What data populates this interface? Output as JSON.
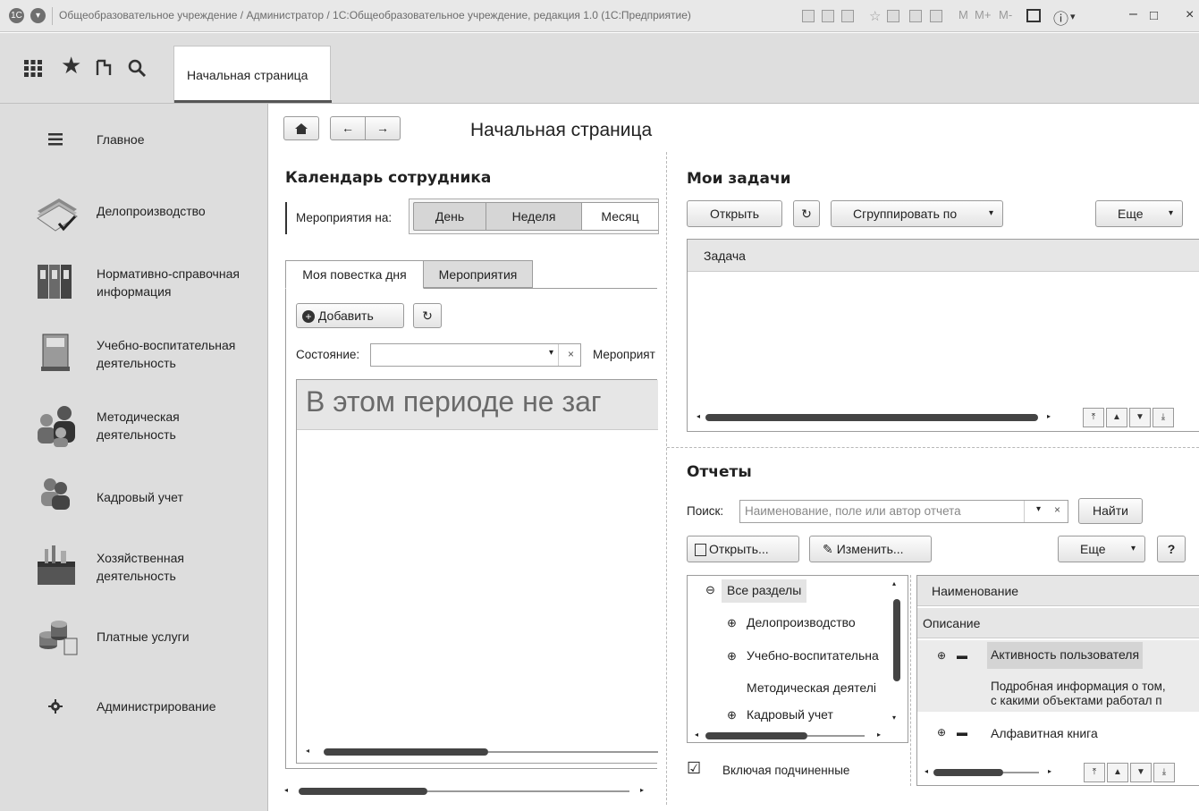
{
  "window": {
    "title": "Общеобразовательное учреждение / Администратор / 1С:Общеобразовательное учреждение, редакция 1.0  (1С:Предприятие)",
    "memory_buttons": [
      "M",
      "M+",
      "M-"
    ]
  },
  "toolbar": {
    "home_tab_label": "Начальная страница"
  },
  "sidebar": {
    "items": [
      {
        "label": "Главное",
        "icon": "menu-icon"
      },
      {
        "label": "Делопроизводство",
        "icon": "documents-icon"
      },
      {
        "label": "Нормативно-справочная информация",
        "icon": "binders-icon"
      },
      {
        "label": "Учебно-воспитательная деятельность",
        "icon": "book-icon"
      },
      {
        "label": "Методическая деятельность",
        "icon": "teachers-icon"
      },
      {
        "label": "Кадровый учет",
        "icon": "staff-icon"
      },
      {
        "label": "Хозяйственная деятельность",
        "icon": "toolbox-icon"
      },
      {
        "label": "Платные услуги",
        "icon": "coins-icon"
      },
      {
        "label": "Администрирование",
        "icon": "gear-icon"
      }
    ]
  },
  "page": {
    "title": "Начальная страница"
  },
  "calendar": {
    "title": "Календарь сотрудника",
    "events_on_label": "Мероприятия на:",
    "period_buttons": [
      "День",
      "Неделя",
      "Месяц"
    ],
    "tabs": [
      "Моя повестка дня",
      "Мероприятия"
    ],
    "add_label": "Добавить",
    "state_label": "Состояние:",
    "events_label_cut": "Мероприят",
    "empty_text": "В этом периоде не заг"
  },
  "tasks": {
    "title": "Мои задачи",
    "open_label": "Открыть",
    "group_by_label": "Сгруппировать по",
    "more_label": "Еще",
    "column_header": "Задача"
  },
  "reports": {
    "title": "Отчеты",
    "search_label": "Поиск:",
    "search_placeholder": "Наименование, поле или автор отчета",
    "find_label": "Найти",
    "open_label": "Открыть...",
    "edit_label": "Изменить...",
    "more_label": "Еще",
    "help_label": "?",
    "tree": [
      {
        "label": "Все разделы",
        "toggle": "⊖"
      },
      {
        "label": "Делопроизводство",
        "toggle": "⊕"
      },
      {
        "label": "Учебно-воспитательна",
        "toggle": "⊕"
      },
      {
        "label": "Методическая деятелі",
        "toggle": ""
      },
      {
        "label": "Кадровый учет",
        "toggle": "⊕"
      }
    ],
    "grid_header_name": "Наименование",
    "grid_header_desc": "Описание",
    "rows": [
      {
        "name": "Активность пользователя",
        "desc_line1": "Подробная информация о том,",
        "desc_line2": "с какими объектами работал п"
      },
      {
        "name": "Алфавитная книга"
      }
    ],
    "include_sub_label": "Включая подчиненные"
  }
}
